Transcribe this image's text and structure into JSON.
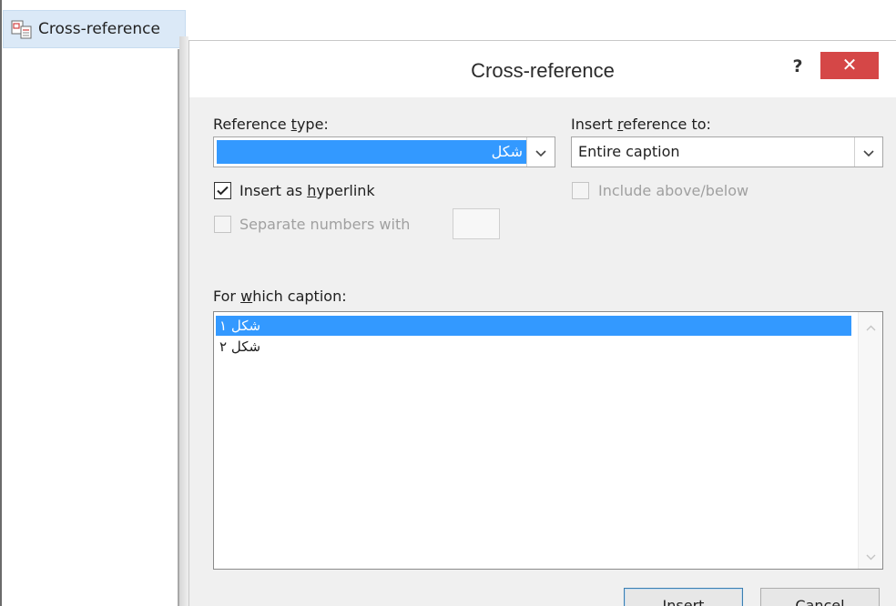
{
  "ribbon": {
    "cross_reference_button": "Cross-reference",
    "icon": "cross-reference-icon"
  },
  "dialog": {
    "title": "Cross-reference",
    "help_label": "?",
    "close_label": "✕",
    "reference_type": {
      "label_pre": "Reference ",
      "label_access": "t",
      "label_post": "ype:",
      "value": "شکل"
    },
    "insert_reference_to": {
      "label_pre": "Insert ",
      "label_access": "r",
      "label_post": "eference to:",
      "value": "Entire caption"
    },
    "insert_as_hyperlink": {
      "label_pre": "Insert as ",
      "label_access": "h",
      "label_post": "yperlink",
      "checked": true
    },
    "include_above_below": {
      "label": "Include above/below",
      "checked": false,
      "enabled": false
    },
    "separate_numbers": {
      "label": "Separate numbers with",
      "checked": false,
      "enabled": false,
      "value": ""
    },
    "for_which_caption": {
      "label_pre": "For ",
      "label_access": "w",
      "label_post": "hich caption:",
      "items": [
        "شکل ۱",
        "شکل ۲"
      ],
      "selected_index": 0
    },
    "buttons": {
      "insert_access": "I",
      "insert_rest": "nsert",
      "cancel": "Cancel"
    }
  }
}
